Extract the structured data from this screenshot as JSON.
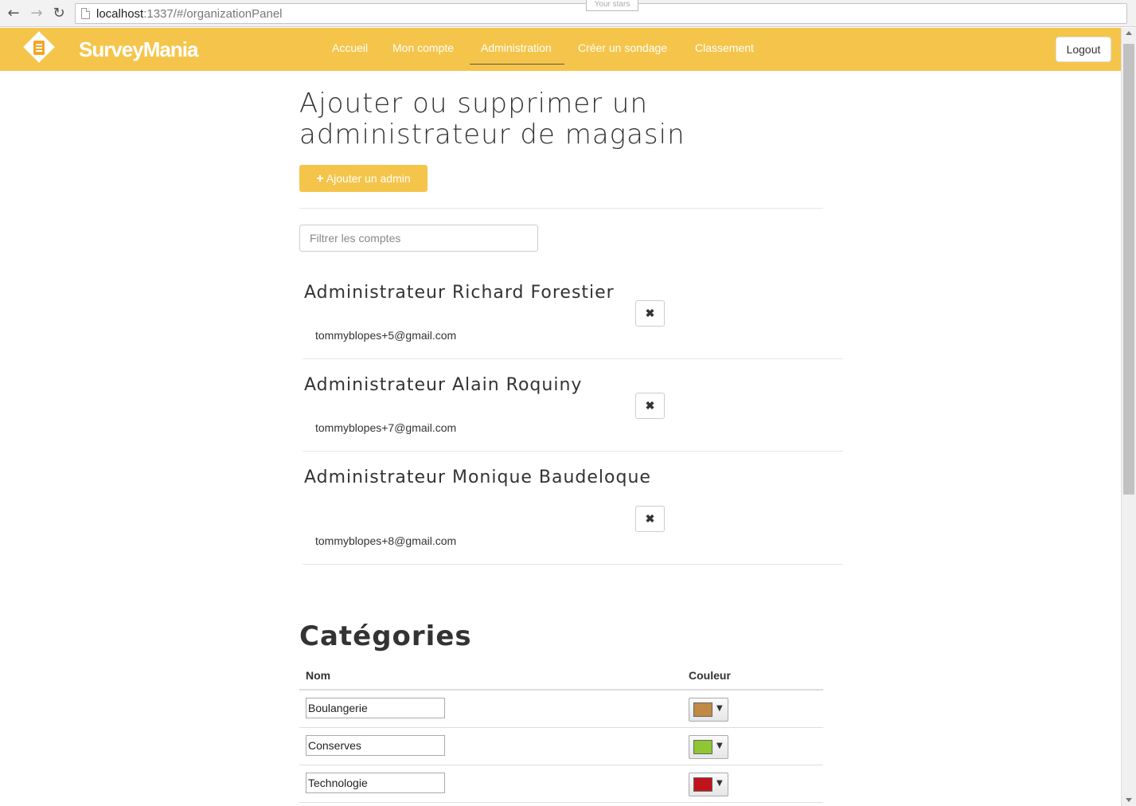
{
  "browser": {
    "url_host": "localhost",
    "url_rest": ":1337/#/organizationPanel",
    "tooltip": "Your stars"
  },
  "navbar": {
    "brand": "SurveyMania",
    "links": [
      {
        "label": "Accueil",
        "active": false
      },
      {
        "label": "Mon compte",
        "active": false
      },
      {
        "label": "Administration",
        "active": true
      },
      {
        "label": "Créer un sondage",
        "active": false
      },
      {
        "label": "Classement",
        "active": false
      }
    ],
    "logout_label": "Logout",
    "accent_color": "#f5c54b"
  },
  "admins_section": {
    "title": "Ajouter ou supprimer un administrateur de magasin",
    "add_button_label": "Ajouter un admin",
    "filter_placeholder": "Filtrer les comptes",
    "admins": [
      {
        "name": "Administrateur Richard Forestier",
        "email": "tommyblopes+5@gmail.com",
        "delete_icon": "close-icon"
      },
      {
        "name": "Administrateur Alain Roquiny",
        "email": "tommyblopes+7@gmail.com",
        "delete_icon": "close-icon"
      },
      {
        "name": "Administrateur Monique Baudeloque",
        "email": "tommyblopes+8@gmail.com",
        "delete_icon": "close-icon"
      }
    ]
  },
  "categories_section": {
    "title": "Catégories",
    "columns": [
      "Nom",
      "Couleur"
    ],
    "rows": [
      {
        "name": "Boulangerie",
        "color": "#c08a45"
      },
      {
        "name": "Conserves",
        "color": "#8fc631"
      },
      {
        "name": "Technologie",
        "color": "#c0131b"
      }
    ]
  }
}
